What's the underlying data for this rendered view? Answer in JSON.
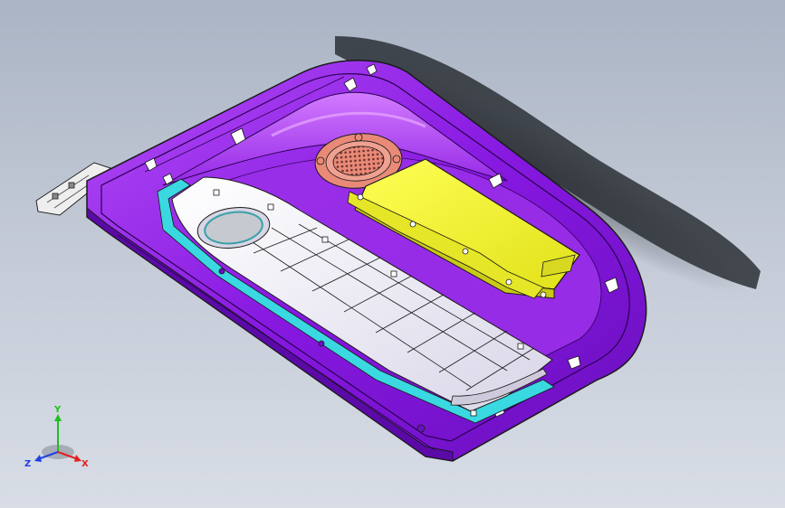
{
  "scene": {
    "part_color": "#8a1fe6",
    "part_highlight": "#c45cff",
    "insert_color": "#eceaf4",
    "module_color": "#f2f22a",
    "speaker_color": "#e98a78",
    "trim_color": "#36d9e0",
    "shadow_color": "#2f3338",
    "edge_color": "#1a1a1a"
  },
  "triad": {
    "y_label": "Y",
    "x_label": "X",
    "z_label": "Z",
    "y_color": "#1fbf1f",
    "x_color": "#e02020",
    "z_color": "#2040e0"
  }
}
